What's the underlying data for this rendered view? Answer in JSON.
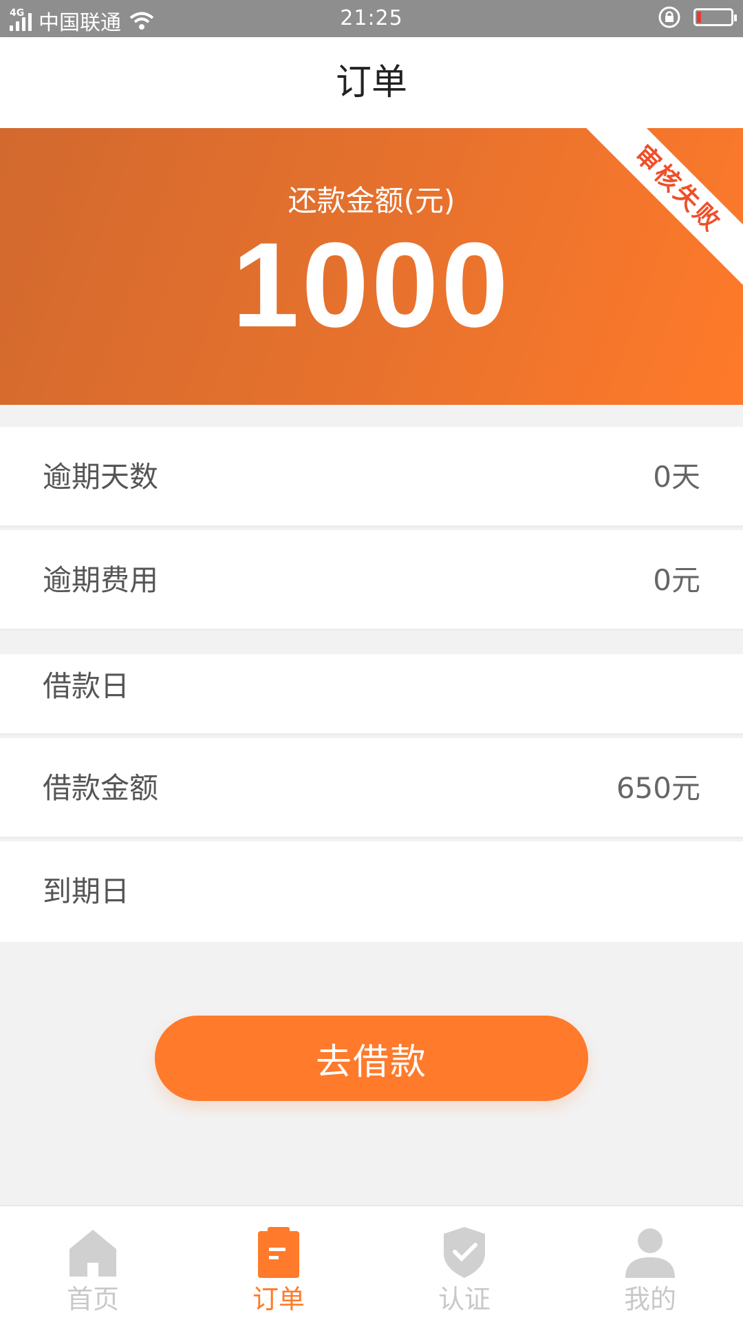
{
  "status_bar": {
    "network": "4G",
    "carrier": "中国联通",
    "time": "21:25",
    "battery_level": 0.12
  },
  "header": {
    "title": "订单"
  },
  "hero": {
    "label": "还款金额(元)",
    "amount": "1000",
    "ribbon": "审核失败"
  },
  "rows": [
    {
      "label": "逾期天数",
      "value": "0天"
    },
    {
      "label": "逾期费用",
      "value": "0元"
    },
    {
      "label": "借款日",
      "value": ""
    },
    {
      "label": "借款金额",
      "value": "650元"
    },
    {
      "label": "到期日",
      "value": ""
    }
  ],
  "cta": {
    "label": "去借款"
  },
  "tabs": [
    {
      "label": "首页",
      "icon": "home-icon",
      "active": false
    },
    {
      "label": "订单",
      "icon": "order-icon",
      "active": true
    },
    {
      "label": "认证",
      "icon": "shield-check-icon",
      "active": false
    },
    {
      "label": "我的",
      "icon": "user-icon",
      "active": false
    }
  ],
  "colors": {
    "accent": "#ff7a2a",
    "status_bar": "#8e8e8e",
    "ribbon_text": "#ef4f2a",
    "inactive": "#c8c8c8"
  }
}
